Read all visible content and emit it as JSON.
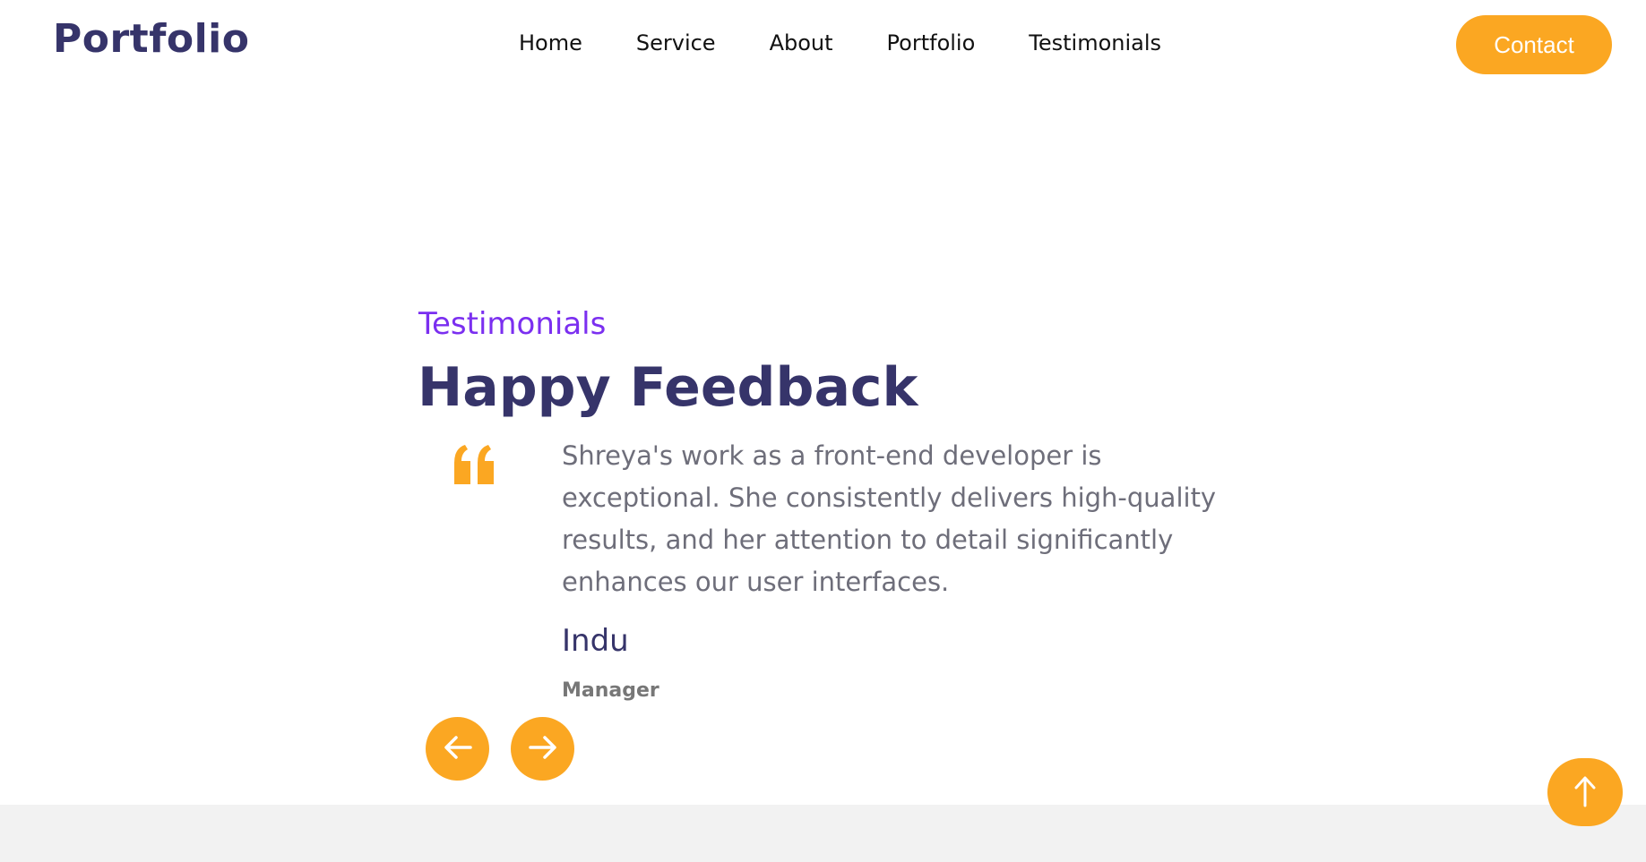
{
  "header": {
    "logo": "Portfolio",
    "nav": [
      "Home",
      "Service",
      "About",
      "Portfolio",
      "Testimonials"
    ],
    "contact_label": "Contact"
  },
  "testimonials": {
    "eyebrow": "Testimonials",
    "heading": "Happy Feedback",
    "quote": "Shreya's work as a front-end developer is exceptional. She consistently delivers high-quality results, and her attention to detail significantly enhances our user interfaces.",
    "author": "Indu",
    "role": "Manager",
    "icons": {
      "quote": "quote-icon",
      "prev": "arrow-left-icon",
      "next": "arrow-right-icon"
    }
  },
  "scroll_top": {
    "icon": "arrow-up-icon"
  },
  "colors": {
    "accent": "#fba722",
    "brand": "#36346a",
    "eyebrow": "#7b2ff0",
    "body_text": "#6e6e7a",
    "footer_band": "#f2f2f2"
  }
}
